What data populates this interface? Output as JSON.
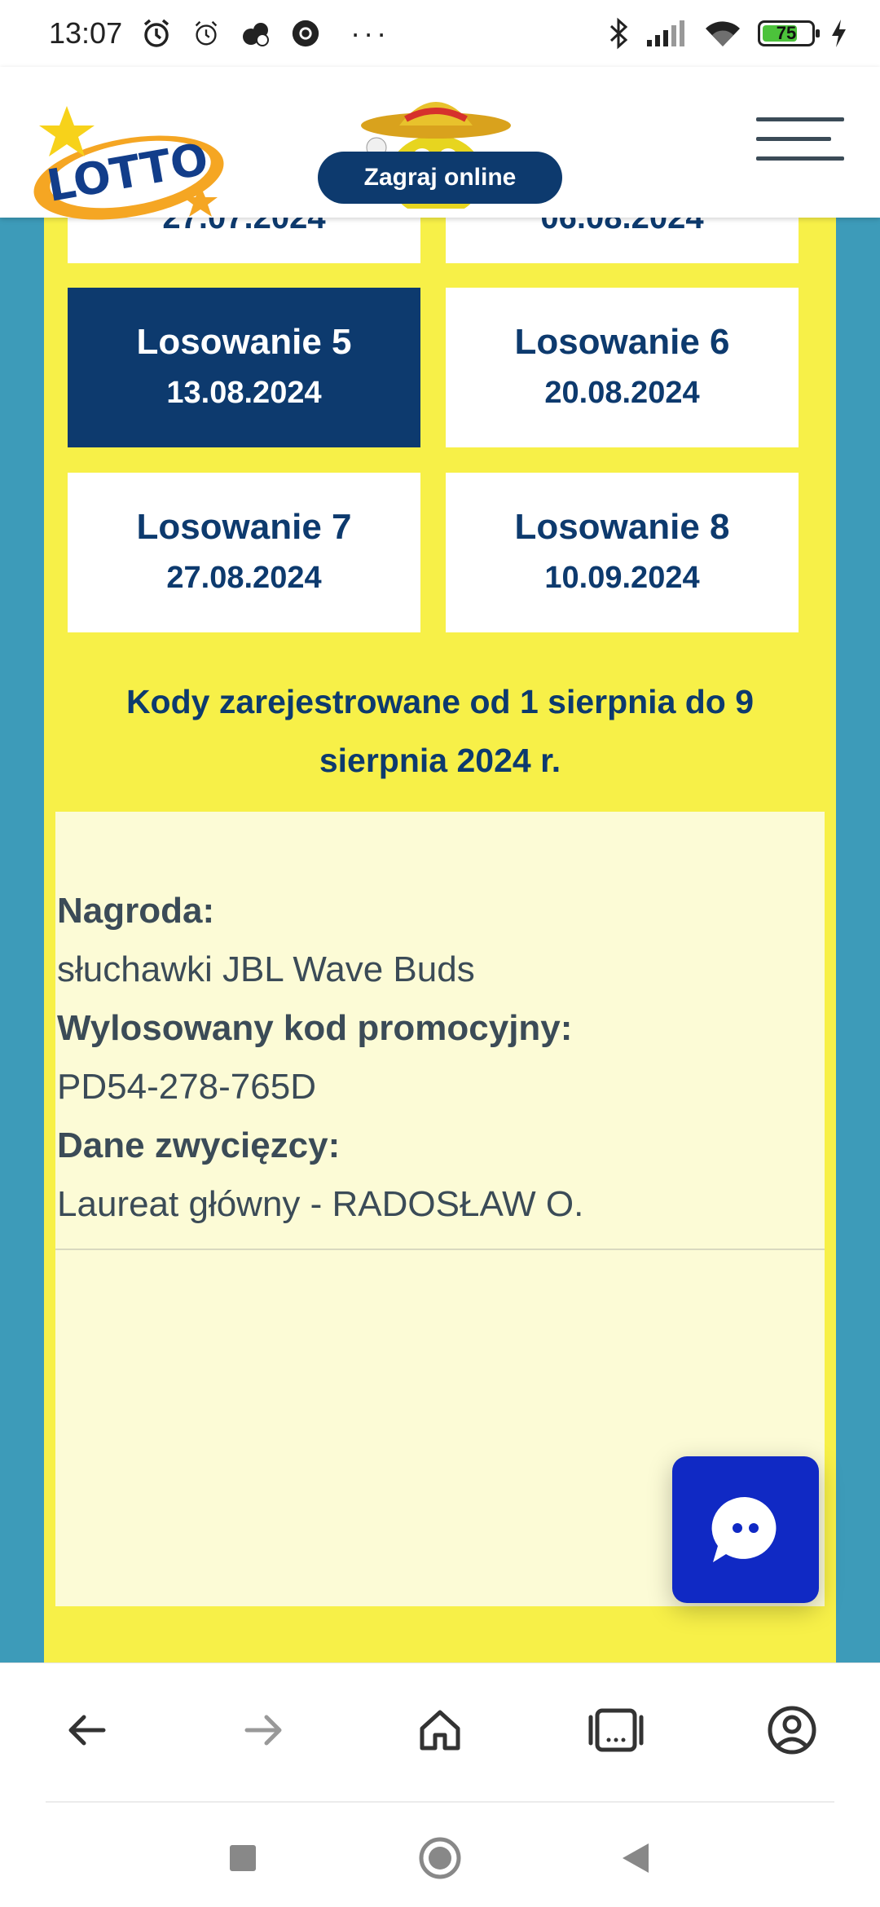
{
  "status_bar": {
    "time": "13:07",
    "battery_level": "75",
    "battery_fraction": 0.75,
    "more_indicator": "···"
  },
  "header": {
    "logo_text": "LOTTO",
    "play_online_label": "Zagraj online",
    "menu_icon": "hamburger-menu-icon"
  },
  "partial_cards": {
    "left_date_fragment": "27.07.2024",
    "right_date_fragment": "06.08.2024"
  },
  "draws": [
    {
      "name": "Losowanie 5",
      "date": "13.08.2024",
      "active": true
    },
    {
      "name": "Losowanie 6",
      "date": "20.08.2024",
      "active": false
    },
    {
      "name": "Losowanie 7",
      "date": "27.08.2024",
      "active": false
    },
    {
      "name": "Losowanie 8",
      "date": "10.09.2024",
      "active": false
    }
  ],
  "codes_heading": "Kody zarejestrowane od 1 sierpnia do 9 sierpnia 2024 r.",
  "result": {
    "prize_label": "Nagroda:",
    "prize_value": "słuchawki JBL Wave Buds",
    "code_label": "Wylosowany kod promocyjny:",
    "code_value": "PD54-278-765D",
    "winner_label": "Dane zwycięzcy:",
    "winner_value": "Laureat główny - RADOSŁAW O."
  },
  "chat_button": {
    "icon": "chat-bubble-icon"
  },
  "browser_nav": {
    "icons": [
      "back-arrow-icon",
      "forward-arrow-icon",
      "home-icon",
      "tabs-icon",
      "account-icon"
    ]
  },
  "system_nav": {
    "icons": [
      "recents-square-icon",
      "home-circle-icon",
      "back-triangle-icon"
    ]
  },
  "colors": {
    "navy": "#0d3a6e",
    "yellow": "#f7f048",
    "teal_bg": "#3d9bb9",
    "chat_blue": "#1029c4",
    "result_bg": "#fcfbd6"
  }
}
